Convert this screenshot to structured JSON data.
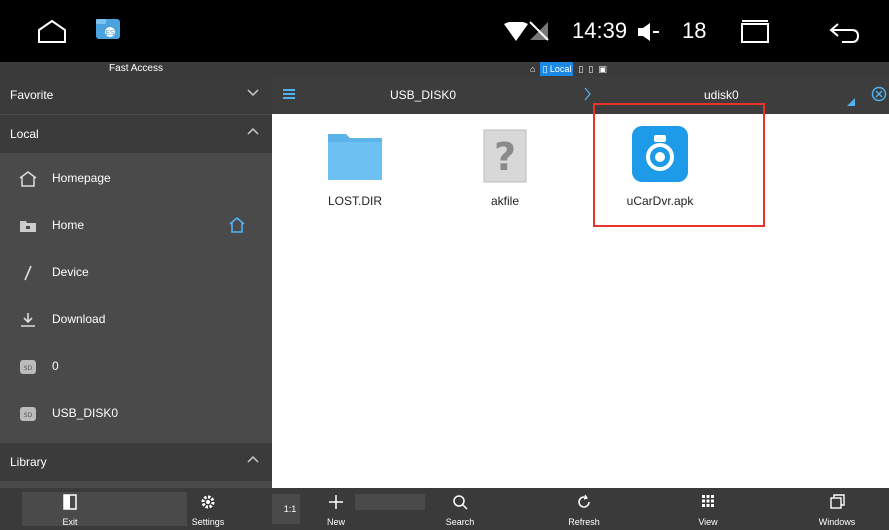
{
  "status_bar": {
    "time": "14:39",
    "volume": "18",
    "icons": [
      "home-icon",
      "es-app-icon",
      "wifi-icon",
      "no-sim-icon",
      "volume-icon",
      "recent-apps-icon",
      "back-icon"
    ]
  },
  "fast_access": {
    "label": "Fast Access",
    "path_chip": "Local"
  },
  "sidebar": {
    "favorite": "Favorite",
    "local": "Local",
    "items": [
      {
        "label": "Homepage",
        "icon": "home-outline-icon"
      },
      {
        "label": "Home",
        "icon": "folder-home-icon"
      },
      {
        "label": "Device",
        "icon": "slash-icon"
      },
      {
        "label": "Download",
        "icon": "download-icon"
      },
      {
        "label": "0",
        "icon": "sd-card-icon"
      },
      {
        "label": "USB_DISK0",
        "icon": "sd-card-icon"
      }
    ],
    "library": "Library"
  },
  "path_bar": {
    "segment1": "USB_DISK0",
    "segment2": "udisk0"
  },
  "files": [
    {
      "name": "LOST.DIR",
      "icon": "folder-icon"
    },
    {
      "name": "akfile",
      "icon": "unknown-file-icon"
    },
    {
      "name": "uCarDvr.apk",
      "icon": "dashcam-app-icon"
    }
  ],
  "toolbar": {
    "exit": "Exit",
    "settings": "Settings",
    "ratio": "1:1",
    "new": "New",
    "search": "Search",
    "refresh": "Refresh",
    "view": "View",
    "windows": "Windows"
  },
  "colors": {
    "accent": "#1e88e5",
    "highlight_box": "#e8332b",
    "sidebar_bg": "#4a4a4a",
    "header_bg": "#3b3b3b"
  }
}
